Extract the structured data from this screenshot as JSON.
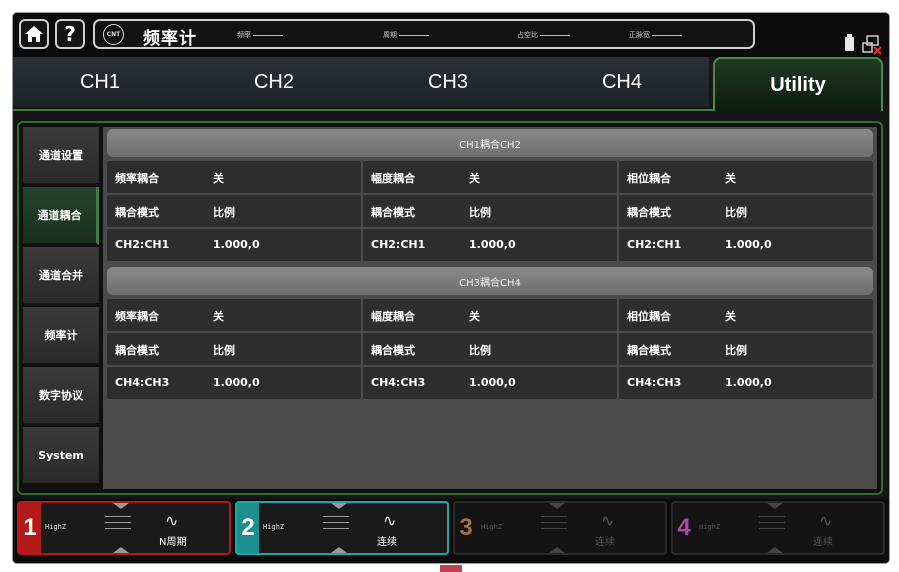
{
  "topbar": {
    "mode_icon": "CNT",
    "mode_title": "频率计",
    "fields": [
      {
        "label": "频率"
      },
      {
        "label": "周期"
      },
      {
        "label": "占空比"
      },
      {
        "label": "正脉宽"
      }
    ],
    "help_label": "?"
  },
  "tabs": [
    {
      "label": "CH1"
    },
    {
      "label": "CH2"
    },
    {
      "label": "CH3"
    },
    {
      "label": "CH4"
    },
    {
      "label": "Utility",
      "active": true
    }
  ],
  "sidebar": {
    "items": [
      {
        "label": "通道设置"
      },
      {
        "label": "通道耦合",
        "active": true
      },
      {
        "label": "通道合并"
      },
      {
        "label": "频率计"
      },
      {
        "label": "数字协议"
      },
      {
        "label": "System"
      }
    ]
  },
  "groups": [
    {
      "title": "CH1耦合CH2",
      "rows": [
        [
          {
            "label": "频率耦合",
            "value": "关"
          },
          {
            "label": "幅度耦合",
            "value": "关"
          },
          {
            "label": "相位耦合",
            "value": "关"
          }
        ],
        [
          {
            "label": "耦合模式",
            "value": "比例"
          },
          {
            "label": "耦合模式",
            "value": "比例"
          },
          {
            "label": "耦合模式",
            "value": "比例"
          }
        ],
        [
          {
            "label": "CH2:CH1",
            "value": "1.000,0"
          },
          {
            "label": "CH2:CH1",
            "value": "1.000,0"
          },
          {
            "label": "CH2:CH1",
            "value": "1.000,0"
          }
        ]
      ]
    },
    {
      "title": "CH3耦合CH4",
      "rows": [
        [
          {
            "label": "频率耦合",
            "value": "关"
          },
          {
            "label": "幅度耦合",
            "value": "关"
          },
          {
            "label": "相位耦合",
            "value": "关"
          }
        ],
        [
          {
            "label": "耦合模式",
            "value": "比例"
          },
          {
            "label": "耦合模式",
            "value": "比例"
          },
          {
            "label": "耦合模式",
            "value": "比例"
          }
        ],
        [
          {
            "label": "CH4:CH3",
            "value": "1.000,0"
          },
          {
            "label": "CH4:CH3",
            "value": "1.000,0"
          },
          {
            "label": "CH4:CH3",
            "value": "1.000,0"
          }
        ]
      ]
    }
  ],
  "channels": [
    {
      "number": "1",
      "impedance": "HighZ",
      "wave_icon": "sine-icon",
      "mode": "N周期",
      "color": "#b51a1a",
      "enabled": true
    },
    {
      "number": "2",
      "impedance": "HighZ",
      "wave_icon": "sine-icon",
      "mode": "连续",
      "color": "#1b8f8f",
      "enabled": true
    },
    {
      "number": "3",
      "impedance": "HighZ",
      "wave_icon": "sine-icon",
      "mode": "连续",
      "color": "#a0703a",
      "enabled": false
    },
    {
      "number": "4",
      "impedance": "HighZ",
      "wave_icon": "sine-icon",
      "mode": "连续",
      "color": "#b04aa8",
      "enabled": false
    }
  ],
  "colors": {
    "active_green": "#3b7f42",
    "panel_gray": "#4b4b4b",
    "cell_dark": "#2e2e2e"
  }
}
